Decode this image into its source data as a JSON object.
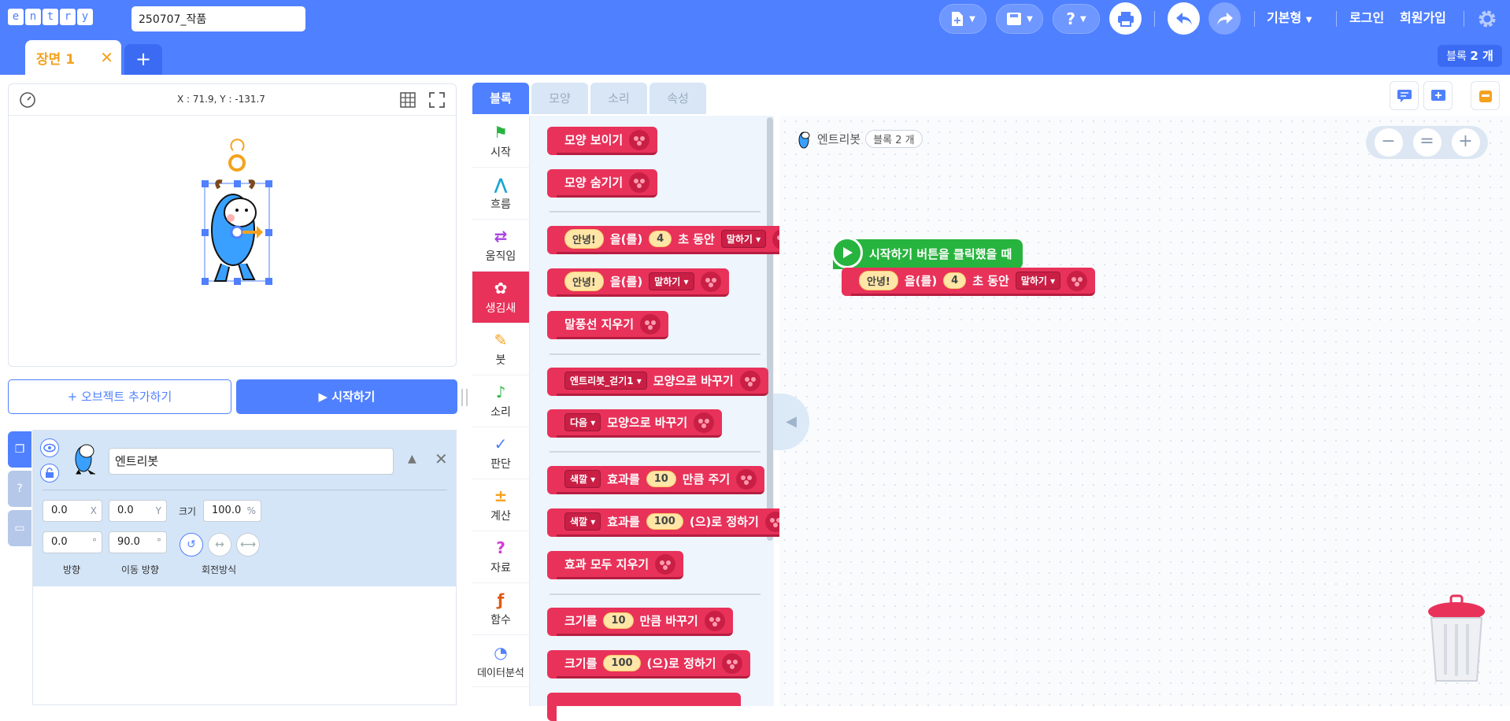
{
  "header": {
    "logo_letters": [
      "e",
      "n",
      "t",
      "r",
      "y"
    ],
    "project_title": "250707_작품",
    "mode_label": "기본형",
    "login_label": "로그인",
    "signup_label": "회원가입",
    "help_label": "?",
    "accent_color": "#4f80ff"
  },
  "scenes": {
    "tabs": [
      {
        "label": "장면 1",
        "close": "✕"
      }
    ],
    "add_label": "+",
    "block_count_prefix": "블록",
    "block_count_value": "2 개"
  },
  "stage": {
    "coords": "X : 71.9, Y : -131.7",
    "add_object_label": "+ 오브젝트 추가하기",
    "start_label": "▶ 시작하기"
  },
  "object": {
    "name": "엔트리봇",
    "x_value": "0.0",
    "x_unit": "X",
    "y_value": "0.0",
    "y_unit": "Y",
    "size_label": "크기",
    "size_value": "100.0",
    "size_unit": "%",
    "direction_value": "0.0",
    "direction_unit": "°",
    "move_direction_value": "90.0",
    "move_direction_unit": "°",
    "direction_label": "방향",
    "move_direction_label": "이동 방향",
    "rotation_label": "회전방식",
    "side_tab_help": "?"
  },
  "code_tabs": [
    "블록",
    "모양",
    "소리",
    "속성"
  ],
  "categories": [
    {
      "label": "시작",
      "icon": "flag-icon",
      "glyph": "⚑",
      "color": "#27b43e"
    },
    {
      "label": "흐름",
      "icon": "flow-icon",
      "glyph": "⋀",
      "color": "#18a5d4"
    },
    {
      "label": "움직임",
      "icon": "move-icon",
      "glyph": "⇄",
      "color": "#a745e0"
    },
    {
      "label": "생김새",
      "icon": "looks-icon",
      "glyph": "✿",
      "color": "#ffffff"
    },
    {
      "label": "붓",
      "icon": "brush-icon",
      "glyph": "✎",
      "color": "#f4a21e"
    },
    {
      "label": "소리",
      "icon": "sound-icon",
      "glyph": "♪",
      "color": "#2eb84a"
    },
    {
      "label": "판단",
      "icon": "judge-icon",
      "glyph": "✓",
      "color": "#4f80ff"
    },
    {
      "label": "계산",
      "icon": "calc-icon",
      "glyph": "±",
      "color": "#f4a21e"
    },
    {
      "label": "자료",
      "icon": "data-icon",
      "glyph": "?",
      "color": "#d63ad6"
    },
    {
      "label": "함수",
      "icon": "function-icon",
      "glyph": "ƒ",
      "color": "#e05a18"
    },
    {
      "label": "데이터분석",
      "icon": "chart-icon",
      "glyph": "◔",
      "color": "#4f80ff"
    }
  ],
  "palette": {
    "show": "모양 보이기",
    "hide": "모양 숨기기",
    "say_timed": {
      "text": "안녕!",
      "p1": "을(를)",
      "sec": "4",
      "p2": "초 동안",
      "mode": "말하기"
    },
    "say": {
      "text": "안녕!",
      "p1": "을(를)",
      "mode": "말하기"
    },
    "clear_bubble": "말풍선 지우기",
    "change_shape": {
      "shape": "엔트리봇_걷기1",
      "p": "모양으로 바꾸기"
    },
    "next_shape": {
      "sel": "다음",
      "p": "모양으로 바꾸기"
    },
    "effect_add": {
      "sel": "색깔",
      "p1": "효과를",
      "v": "10",
      "p2": "만큼 주기"
    },
    "effect_set": {
      "sel": "색깔",
      "p1": "효과를",
      "v": "100",
      "p2": "(으)로 정하기"
    },
    "effect_clear": "효과 모두 지우기",
    "size_change": {
      "p1": "크기를",
      "v": "10",
      "p2": "만큼 바꾸기"
    },
    "size_set": {
      "p1": "크기를",
      "v": "100",
      "p2": "(으)로 정하기"
    }
  },
  "workspace": {
    "object_name": "엔트리봇",
    "block_count": "블록 2 개",
    "start_block": "시작하기 버튼을 클릭했을 때",
    "say_block": {
      "text": "안녕!",
      "p1": "을(를)",
      "sec": "4",
      "p2": "초 동안",
      "mode": "말하기"
    },
    "zoom_out": "−",
    "zoom_reset": "=",
    "zoom_in": "+"
  }
}
